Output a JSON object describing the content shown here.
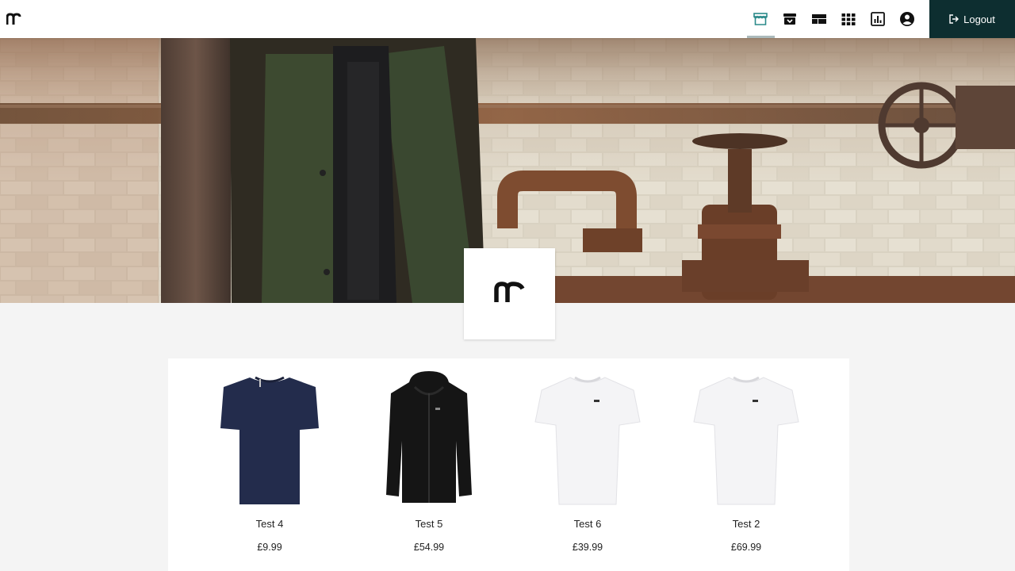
{
  "navbar": {
    "logo_icon": "brand-logo-icon",
    "icons": [
      {
        "name": "storefront-icon",
        "active": true
      },
      {
        "name": "archive-icon",
        "active": false
      },
      {
        "name": "layout-icon",
        "active": false
      },
      {
        "name": "grid-apps-icon",
        "active": false
      },
      {
        "name": "bar-chart-icon",
        "active": false
      },
      {
        "name": "account-circle-icon",
        "active": false
      }
    ],
    "logout_label": "Logout",
    "logout_icon": "logout-icon"
  },
  "colors": {
    "nav_bg": "#ffffff",
    "logout_bg": "#0d2e30",
    "page_bg": "#f4f4f4",
    "panel_bg": "#ffffff"
  },
  "banner": {
    "image": "hero-banner-image",
    "badge_icon": "brand-logo-icon"
  },
  "products": [
    {
      "name": "Test 4",
      "price": "£9.99",
      "image": "navy-tshirt-image"
    },
    {
      "name": "Test 5",
      "price": "£54.99",
      "image": "black-hoodie-image"
    },
    {
      "name": "Test 6",
      "price": "£39.99",
      "image": "white-tshirt-image"
    },
    {
      "name": "Test 2",
      "price": "£69.99",
      "image": "white-tshirt-image"
    }
  ]
}
